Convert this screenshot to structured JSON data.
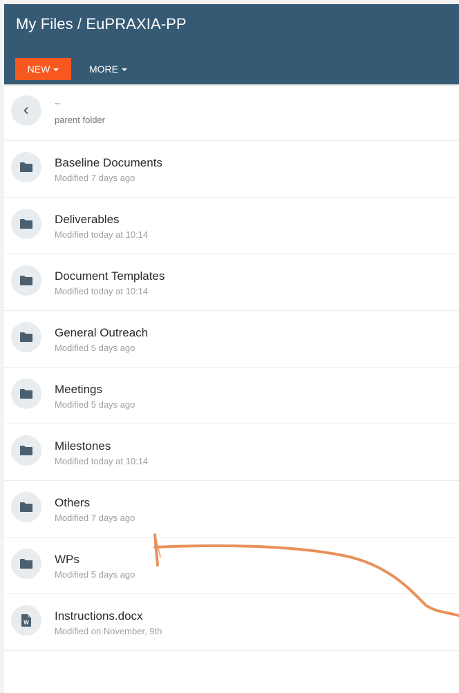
{
  "header": {
    "title": "My Files / EuPRAXIA-PP",
    "new_label": "NEW",
    "more_label": "MORE",
    "bg_color": "#365a74",
    "accent_color": "#f7581f"
  },
  "parent": {
    "name": "..",
    "meta": "parent folder",
    "icon": "chevron-left-icon"
  },
  "items": [
    {
      "name": "Baseline Documents",
      "meta": "Modified 7 days ago",
      "icon": "folder-icon"
    },
    {
      "name": "Deliverables",
      "meta": "Modified today at 10:14",
      "icon": "folder-icon"
    },
    {
      "name": "Document Templates",
      "meta": "Modified today at 10:14",
      "icon": "folder-icon"
    },
    {
      "name": "General Outreach",
      "meta": "Modified 5 days ago",
      "icon": "folder-icon"
    },
    {
      "name": "Meetings",
      "meta": "Modified 5 days ago",
      "icon": "folder-icon"
    },
    {
      "name": "Milestones",
      "meta": "Modified today at 10:14",
      "icon": "folder-icon"
    },
    {
      "name": "Others",
      "meta": "Modified 7 days ago",
      "icon": "folder-icon"
    },
    {
      "name": "WPs",
      "meta": "Modified 5 days ago",
      "icon": "folder-icon"
    },
    {
      "name": "Instructions.docx",
      "meta": "Modified on November, 9th",
      "icon": "word-document-icon"
    }
  ],
  "annotation_color": "#e8915a"
}
